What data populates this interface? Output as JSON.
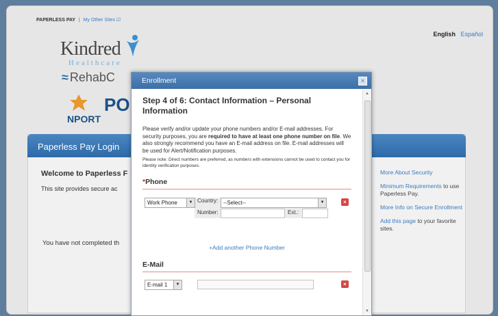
{
  "topbar": {
    "site": "PAPERLESS PAY",
    "separator": "|",
    "other_sites": "My Other Sites"
  },
  "language": {
    "english": "English",
    "espanol": "Español"
  },
  "logos": {
    "kindred": "Kindred",
    "kindred_sub": "Healthcare",
    "rehab": "RehabC",
    "po": "PO",
    "nport": "NPORT"
  },
  "login": {
    "title": "Paperless Pay Login",
    "welcome": "Welcome to Paperless F",
    "provides": "This site provides secure ac",
    "not_completed": "You have not completed th"
  },
  "right_links": [
    {
      "link": "More About Security",
      "rest": ""
    },
    {
      "link": "Minimum Requirements",
      "rest": " to use Paperless Pay."
    },
    {
      "link": "More Info on Secure Enrollment",
      "rest": ""
    },
    {
      "link": "Add this page",
      "rest": " to your favorite sites."
    }
  ],
  "modal": {
    "title": "Enrollment",
    "close": "×",
    "step": "Step 4 of 6: Contact Information – Personal Information",
    "para_a": "Please verify and/or update your phone numbers and/or E-mail addresses. For security purposes, you are ",
    "para_bold": "required to have at least one phone number on file",
    "para_b": ". We also strongly recommend you have an E-mail address on file. E-mail addresses will be used for Alert/Notification purposes.",
    "note": "Please note: Direct numbers are preferred, as numbers with extensions cannot be used to contact you for identity verification purposes.",
    "phone_section": {
      "star": "*",
      "title": "Phone"
    },
    "phone_row": {
      "type": "Work Phone",
      "country_label": "Country:",
      "country_value": "--Select--",
      "number_label": "Number:",
      "ext_label": "Ext.:",
      "delete": "×"
    },
    "add_phone": "+Add another Phone Number",
    "email_section": {
      "title": "E-Mail"
    },
    "email_row": {
      "type": "E-mail 1",
      "value": "",
      "delete": "×"
    }
  }
}
